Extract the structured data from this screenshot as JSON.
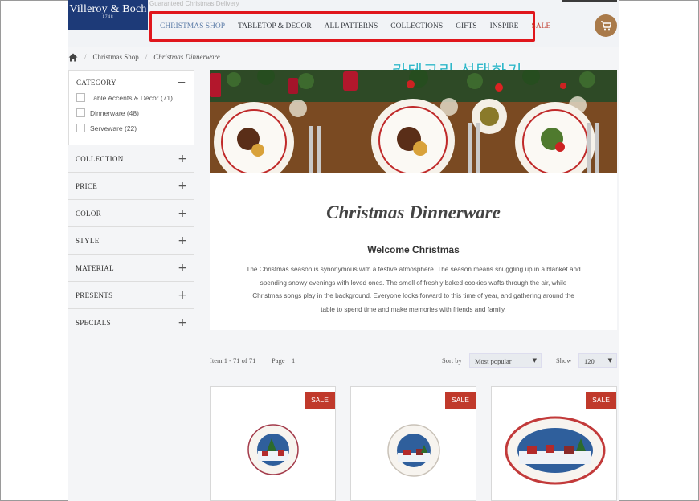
{
  "header": {
    "topline": "Guaranteed Christmas Delivery",
    "logo": {
      "name": "Villeroy & Boch",
      "year": "1748"
    },
    "nav": [
      {
        "label": "CHRISTMAS SHOP"
      },
      {
        "label": "TABLETOP & DECOR"
      },
      {
        "label": "ALL PATTERNS"
      },
      {
        "label": "COLLECTIONS"
      },
      {
        "label": "GIFTS"
      },
      {
        "label": "INSPIRE"
      },
      {
        "label": "SALE"
      }
    ],
    "cart_icon": "cart-icon"
  },
  "breadcrumb": {
    "home_icon": "home-icon",
    "parent": "Christmas Shop",
    "current": "Christmas Dinnerware"
  },
  "annotation": "카테고리 선택하기",
  "sidebar": {
    "category": {
      "title": "CATEGORY",
      "toggle": "−",
      "options": [
        {
          "label": "Table Accents & Decor (71)"
        },
        {
          "label": "Dinnerware (48)"
        },
        {
          "label": "Serveware (22)"
        }
      ]
    },
    "facets": [
      {
        "label": "COLLECTION",
        "toggle": "+"
      },
      {
        "label": "PRICE",
        "toggle": "+"
      },
      {
        "label": "COLOR",
        "toggle": "+"
      },
      {
        "label": "STYLE",
        "toggle": "+"
      },
      {
        "label": "MATERIAL",
        "toggle": "+"
      },
      {
        "label": "PRESENTS",
        "toggle": "+"
      },
      {
        "label": "SPECIALS",
        "toggle": "+"
      }
    ]
  },
  "main": {
    "title": "Christmas Dinnerware",
    "welcome": "Welcome Christmas",
    "description": "The Christmas season is synonymous with a festive atmosphere. The season means snuggling up in a blanket and spending snowy evenings with loved ones. The smell of freshly baked cookies wafts through the air, while Christmas songs play in the background. Everyone looks forward to this time of year, and gathering around the table to spend time and make memories with friends and family."
  },
  "toolbar": {
    "items": "Item 1 - 71 of 71",
    "page_label": "Page",
    "page_value": "1",
    "sort_label": "Sort by",
    "sort_value": "Most popular",
    "show_label": "Show",
    "show_value": "120",
    "arrow": "▼"
  },
  "products": [
    {
      "badge": "SALE"
    },
    {
      "badge": "SALE"
    },
    {
      "badge": "SALE"
    }
  ],
  "colors": {
    "brand": "#1d3a78",
    "sale": "#c0392b",
    "highlight": "#e0161c",
    "annotation": "#2fb7c9",
    "cart": "#a97a4a"
  }
}
